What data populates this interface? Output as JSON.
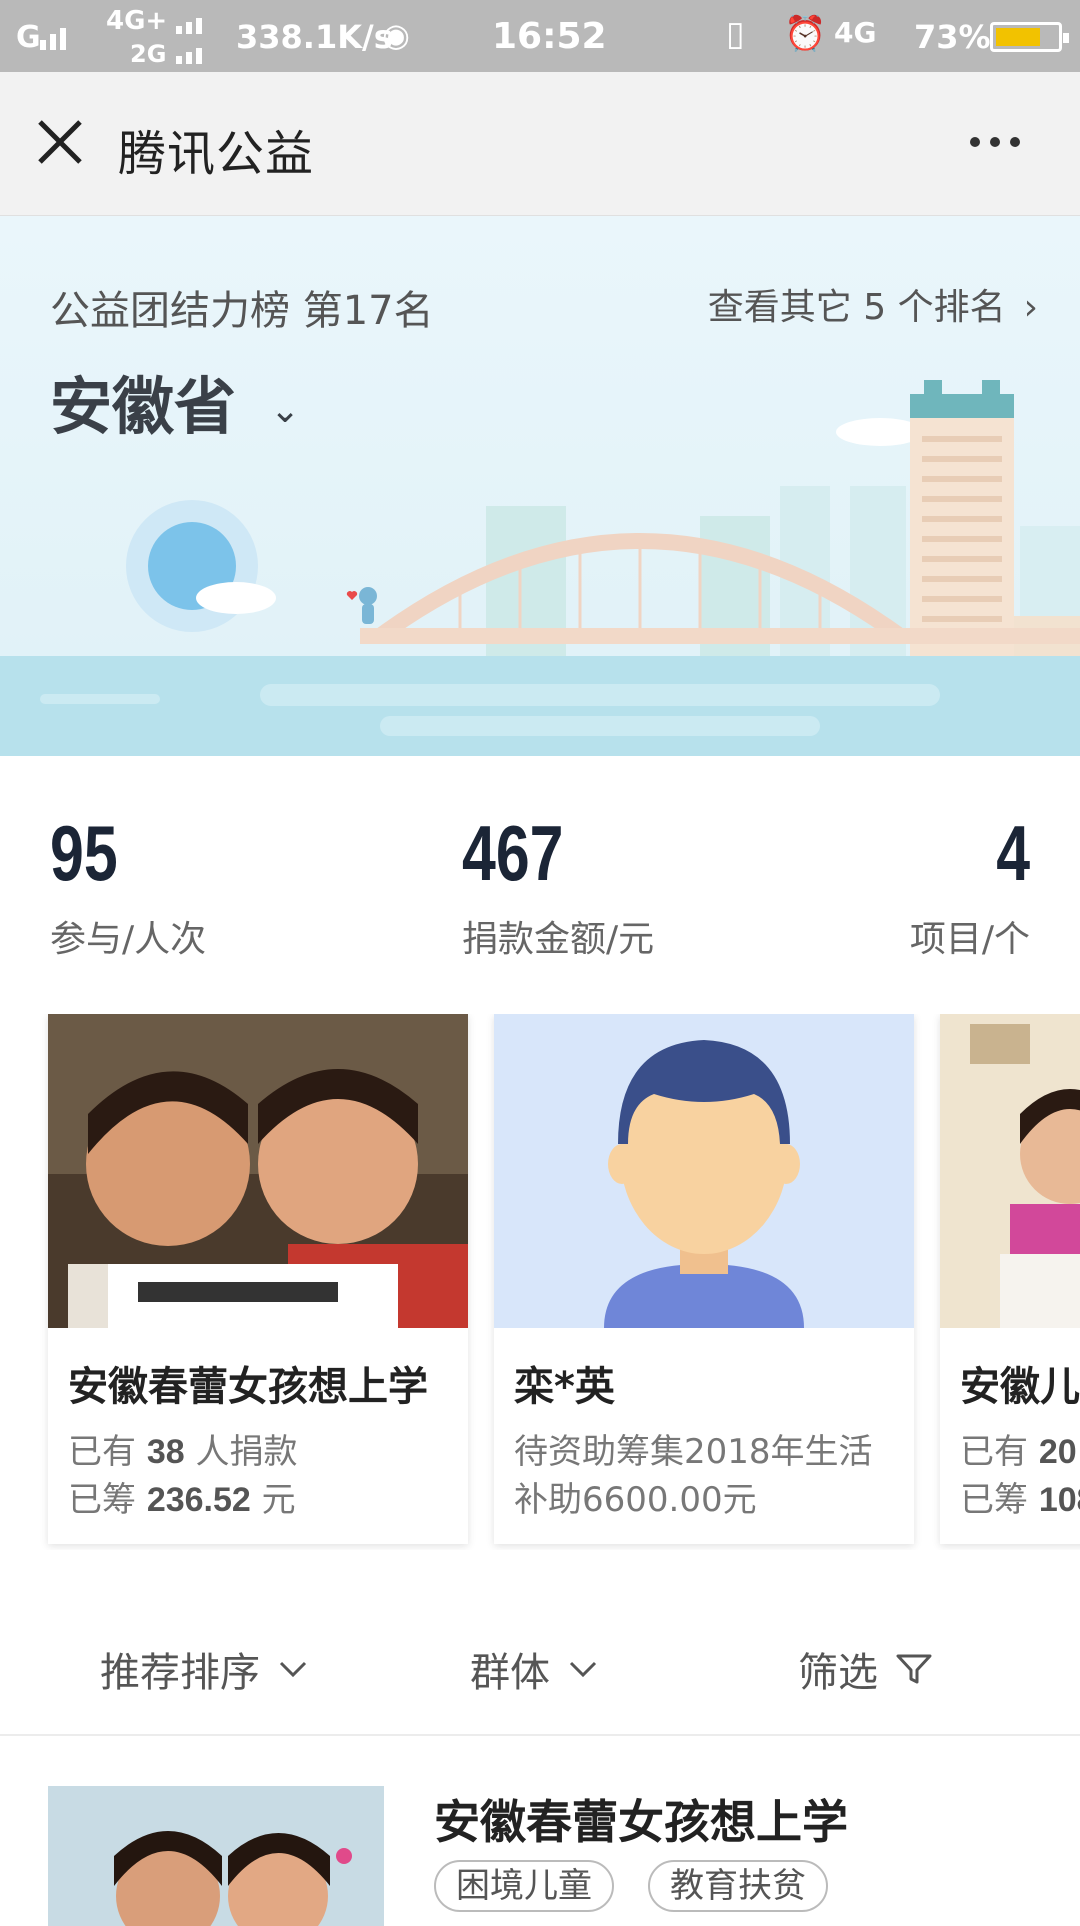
{
  "status_bar": {
    "network1": "G",
    "network2": "4G+",
    "network3": "2G",
    "speed": "338.1K/s",
    "time": "16:52",
    "network4": "4G",
    "battery_pct": "73%",
    "battery_level": 0.73
  },
  "title_bar": {
    "title": "腾讯公益"
  },
  "banner": {
    "rank_text": "公益团结力榜 第17名",
    "more_link": "查看其它 5 个排名",
    "province": "安徽省"
  },
  "stats": [
    {
      "value": "95",
      "label": "参与/人次"
    },
    {
      "value": "467",
      "label": "捐款金额/元"
    },
    {
      "value": "4",
      "label": "项目/个"
    }
  ],
  "cards": [
    {
      "title": "安徽春蕾女孩想上学",
      "line1_prefix": "已有 ",
      "line1_num": "38",
      "line1_suffix": " 人捐款",
      "line2_prefix": "已筹 ",
      "line2_num": "236.52",
      "line2_suffix": " 元"
    },
    {
      "title": "栾*英",
      "line1": "待资助筹集2018年生活",
      "line2": "补助6600.00元"
    },
    {
      "title": "安徽儿",
      "line1_prefix": "已有 ",
      "line1_num": "20",
      "line1_suffix": " ",
      "line2_prefix": "已筹 ",
      "line2_num": "108",
      "line2_suffix": ""
    }
  ],
  "filters": {
    "sort": "推荐排序",
    "group": "群体",
    "filter": "筛选"
  },
  "list": {
    "title": "安徽春蕾女孩想上学",
    "tags": [
      "困境儿童",
      "教育扶贫"
    ]
  },
  "colors": {
    "accent_dark": "#1b2536",
    "banner_bg": "#e4f4f9",
    "battery": "#f2c200"
  }
}
